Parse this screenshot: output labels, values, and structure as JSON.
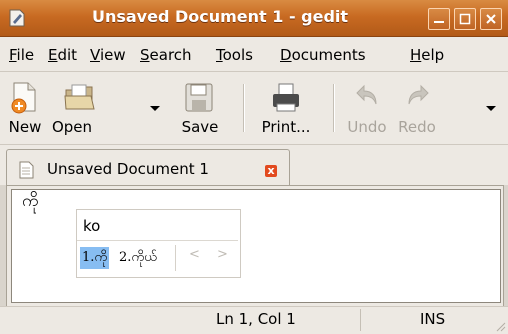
{
  "window": {
    "title": "Unsaved Document 1 - gedit"
  },
  "menu": {
    "items": [
      {
        "u": "F",
        "rest": "ile"
      },
      {
        "u": "E",
        "rest": "dit"
      },
      {
        "u": "V",
        "rest": "iew"
      },
      {
        "u": "S",
        "rest": "earch"
      },
      {
        "u": "T",
        "rest": "ools"
      },
      {
        "u": "D",
        "rest": "ocuments"
      },
      {
        "u": "H",
        "rest": "elp"
      }
    ]
  },
  "toolbar": {
    "new_label": "New",
    "open_label": "Open",
    "save_label": "Save",
    "print_label": "Print...",
    "undo_label": "Undo",
    "redo_label": "Redo"
  },
  "tab": {
    "label": "Unsaved Document 1",
    "close_glyph": "x"
  },
  "editor": {
    "text": "ကို"
  },
  "ime": {
    "preedit": "ko",
    "candidates": [
      "1.ကို",
      "2.ကိုယ်"
    ],
    "prev_glyph": "<",
    "next_glyph": ">"
  },
  "status": {
    "position": "Ln 1, Col 1",
    "mode": "INS"
  },
  "colors": {
    "titlebar": "#c86a22",
    "selection": "#87bdf2",
    "close_tab": "#e24a1f"
  }
}
